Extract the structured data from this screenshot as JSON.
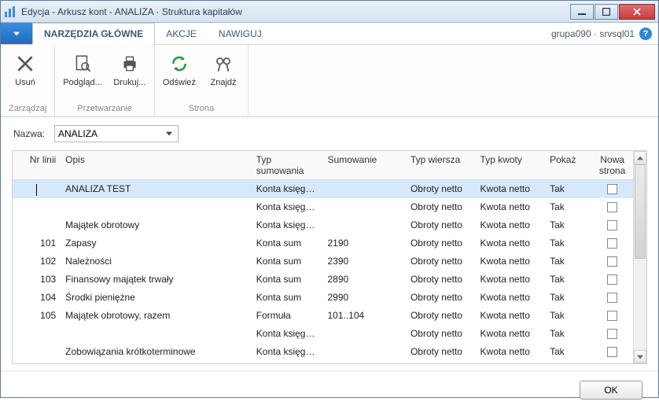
{
  "window": {
    "title": "Edycja - Arkusz kont - ANALIZA · Struktura kapitałów"
  },
  "tabs": {
    "main": "NARZĘDZIA GŁÓWNE",
    "actions": "AKCJE",
    "navigate": "NAWIGUJ"
  },
  "right_info": "grupa090 · srvsql01",
  "ribbon": {
    "delete": "Usuń",
    "preview": "Podgląd...",
    "print": "Drukuj...",
    "refresh": "Odśwież",
    "find": "Znajdź",
    "group_manage": "Zarządzaj",
    "group_process": "Przetwarzanie",
    "group_page": "Strona"
  },
  "filter": {
    "label": "Nazwa:",
    "value": "ANALIZA"
  },
  "grid": {
    "headers": {
      "nr": "Nr linii",
      "opis": "Opis",
      "typ_sum": "Typ sumowania",
      "sumowanie": "Sumowanie",
      "typ_w": "Typ wiersza",
      "typ_k": "Typ kwoty",
      "pokaz": "Pokaż",
      "nowa": "Nowa strona"
    },
    "rows": [
      {
        "nr": "",
        "opis": "ANALIZA TEST",
        "typs": "Konta księgo...",
        "sum": "",
        "typw": "Obroty netto",
        "typk": "Kwota netto",
        "pokaz": "Tak",
        "selected": true
      },
      {
        "nr": "",
        "opis": "",
        "typs": "Konta księgo...",
        "sum": "",
        "typw": "Obroty netto",
        "typk": "Kwota netto",
        "pokaz": "Tak"
      },
      {
        "nr": "",
        "opis": "Majątek obrotowy",
        "typs": "Konta księgo...",
        "sum": "",
        "typw": "Obroty netto",
        "typk": "Kwota netto",
        "pokaz": "Tak"
      },
      {
        "nr": "101",
        "opis": "Zapasy",
        "typs": "Konta sum",
        "sum": "2190",
        "typw": "Obroty netto",
        "typk": "Kwota netto",
        "pokaz": "Tak"
      },
      {
        "nr": "102",
        "opis": "Należności",
        "typs": "Konta sum",
        "sum": "2390",
        "typw": "Obroty netto",
        "typk": "Kwota netto",
        "pokaz": "Tak"
      },
      {
        "nr": "103",
        "opis": "Finansowy majątek trwały",
        "typs": "Konta sum",
        "sum": "2890",
        "typw": "Obroty netto",
        "typk": "Kwota netto",
        "pokaz": "Tak"
      },
      {
        "nr": "104",
        "opis": "Środki pieniężne",
        "typs": "Konta sum",
        "sum": "2990",
        "typw": "Obroty netto",
        "typk": "Kwota netto",
        "pokaz": "Tak"
      },
      {
        "nr": "105",
        "opis": "Majątek obrotowy, razem",
        "typs": "Formuła",
        "sum": "101..104",
        "typw": "Obroty netto",
        "typk": "Kwota netto",
        "pokaz": "Tak"
      },
      {
        "nr": "",
        "opis": "",
        "typs": "Konta księgo...",
        "sum": "",
        "typw": "Obroty netto",
        "typk": "Kwota netto",
        "pokaz": "Tak"
      },
      {
        "nr": "",
        "opis": "Zobowiązania krótkoterminowe",
        "typs": "Konta księgo...",
        "sum": "",
        "typw": "Obroty netto",
        "typk": "Kwota netto",
        "pokaz": "Tak"
      }
    ]
  },
  "footer": {
    "ok": "OK"
  }
}
